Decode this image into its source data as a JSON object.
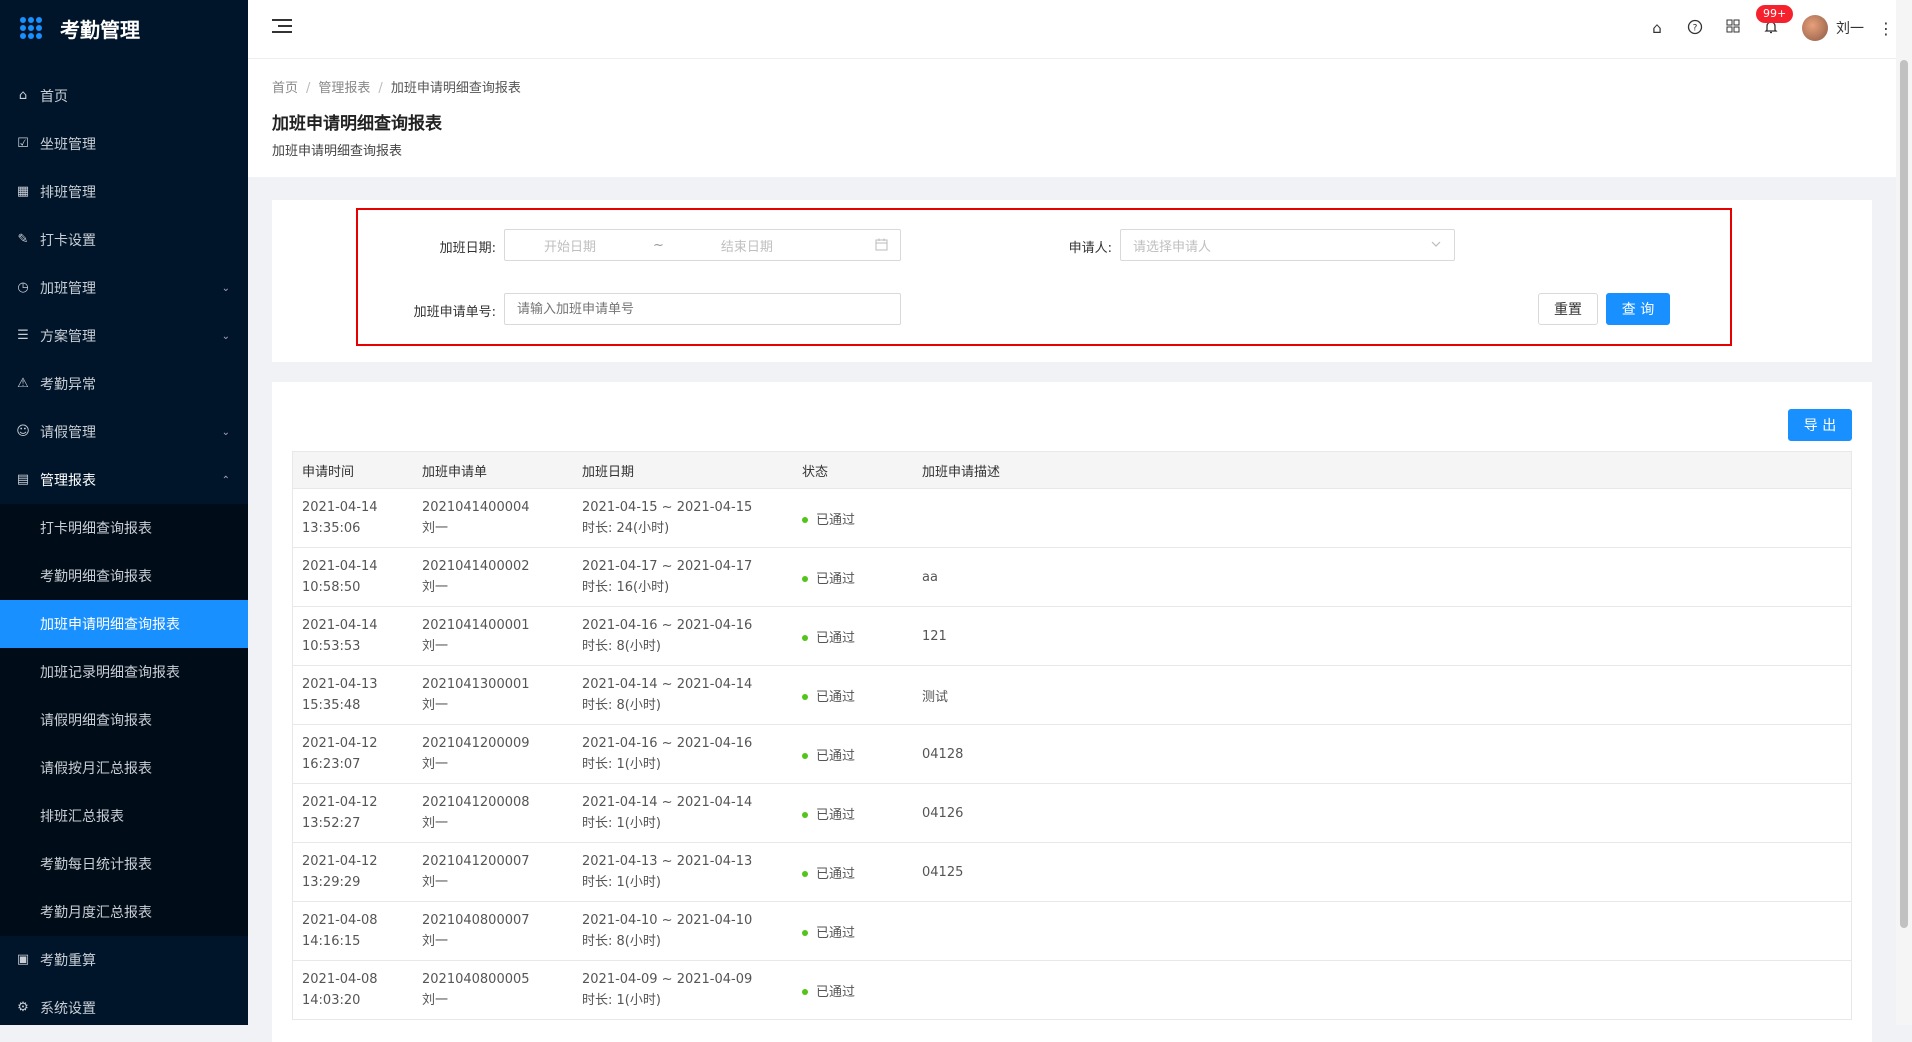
{
  "app": {
    "title": "考勤管理"
  },
  "sidebar": {
    "items": [
      {
        "label": "首页",
        "icon": "home-icon",
        "glyph": "⌂"
      },
      {
        "label": "坐班管理",
        "icon": "checkbox-icon",
        "glyph": "☑"
      },
      {
        "label": "排班管理",
        "icon": "calendar-icon",
        "glyph": "▦"
      },
      {
        "label": "打卡设置",
        "icon": "edit-icon",
        "glyph": "✎"
      },
      {
        "label": "加班管理",
        "icon": "clock-icon",
        "glyph": "◷",
        "arrow": "⌄"
      },
      {
        "label": "方案管理",
        "icon": "document-icon",
        "glyph": "☰",
        "arrow": "⌄"
      },
      {
        "label": "考勤异常",
        "icon": "alarm-icon",
        "glyph": "⚠"
      },
      {
        "label": "请假管理",
        "icon": "smile-icon",
        "glyph": "☺",
        "arrow": "⌄"
      },
      {
        "label": "管理报表",
        "icon": "report-icon",
        "glyph": "▤",
        "arrow": "⌃"
      }
    ],
    "sub_items": [
      "打卡明细查询报表",
      "考勤明细查询报表",
      "加班申请明细查询报表",
      "加班记录明细查询报表",
      "请假明细查询报表",
      "请假按月汇总报表",
      "排班汇总报表",
      "考勤每日统计报表",
      "考勤月度汇总报表"
    ],
    "bottom_items": [
      {
        "label": "考勤重算",
        "icon": "calculator-icon",
        "glyph": "▣"
      },
      {
        "label": "系统设置",
        "icon": "gear-icon",
        "glyph": "⚙"
      }
    ]
  },
  "header": {
    "badge": "99+",
    "user_name": "刘一",
    "icons": [
      "home-icon",
      "help-icon",
      "apps-icon",
      "bell-icon"
    ]
  },
  "page": {
    "breadcrumb": [
      "首页",
      "管理报表",
      "加班申请明细查询报表"
    ],
    "title": "加班申请明细查询报表",
    "subtitle": "加班申请明细查询报表"
  },
  "filters": {
    "date_label": "加班日期:",
    "start_placeholder": "开始日期",
    "range_sep": "~",
    "end_placeholder": "结束日期",
    "applicant_label": "申请人:",
    "applicant_placeholder": "请选择申请人",
    "number_label": "加班申请单号:",
    "number_placeholder": "请输入加班申请单号",
    "reset": "重置",
    "query": "查 询"
  },
  "table": {
    "export": "导 出",
    "headers": [
      "申请时间",
      "加班申请单",
      "加班日期",
      "状态",
      "加班申请描述"
    ],
    "rows": [
      {
        "date": "2021-04-14",
        "time": "13:35:06",
        "no": "2021041400004",
        "user": "刘一",
        "range": "2021-04-15 ~ 2021-04-15",
        "duration": "时长: 24(小时)",
        "status": "已通过",
        "desc": ""
      },
      {
        "date": "2021-04-14",
        "time": "10:58:50",
        "no": "2021041400002",
        "user": "刘一",
        "range": "2021-04-17 ~ 2021-04-17",
        "duration": "时长: 16(小时)",
        "status": "已通过",
        "desc": "aa"
      },
      {
        "date": "2021-04-14",
        "time": "10:53:53",
        "no": "2021041400001",
        "user": "刘一",
        "range": "2021-04-16 ~ 2021-04-16",
        "duration": "时长: 8(小时)",
        "status": "已通过",
        "desc": "121"
      },
      {
        "date": "2021-04-13",
        "time": "15:35:48",
        "no": "2021041300001",
        "user": "刘一",
        "range": "2021-04-14 ~ 2021-04-14",
        "duration": "时长: 8(小时)",
        "status": "已通过",
        "desc": "测试"
      },
      {
        "date": "2021-04-12",
        "time": "16:23:07",
        "no": "2021041200009",
        "user": "刘一",
        "range": "2021-04-16 ~ 2021-04-16",
        "duration": "时长: 1(小时)",
        "status": "已通过",
        "desc": "04128"
      },
      {
        "date": "2021-04-12",
        "time": "13:52:27",
        "no": "2021041200008",
        "user": "刘一",
        "range": "2021-04-14 ~ 2021-04-14",
        "duration": "时长: 1(小时)",
        "status": "已通过",
        "desc": "04126"
      },
      {
        "date": "2021-04-12",
        "time": "13:29:29",
        "no": "2021041200007",
        "user": "刘一",
        "range": "2021-04-13 ~ 2021-04-13",
        "duration": "时长: 1(小时)",
        "status": "已通过",
        "desc": "04125"
      },
      {
        "date": "2021-04-08",
        "time": "14:16:15",
        "no": "2021040800007",
        "user": "刘一",
        "range": "2021-04-10 ~ 2021-04-10",
        "duration": "时长: 8(小时)",
        "status": "已通过",
        "desc": ""
      },
      {
        "date": "2021-04-08",
        "time": "14:03:20",
        "no": "2021040800005",
        "user": "刘一",
        "range": "2021-04-09 ~ 2021-04-09",
        "duration": "时长: 1(小时)",
        "status": "已通过",
        "desc": ""
      }
    ]
  },
  "colors": {
    "sidebar": "#001529",
    "primary": "#1890ff",
    "highlight": "#e60000",
    "success": "#52c41a"
  }
}
